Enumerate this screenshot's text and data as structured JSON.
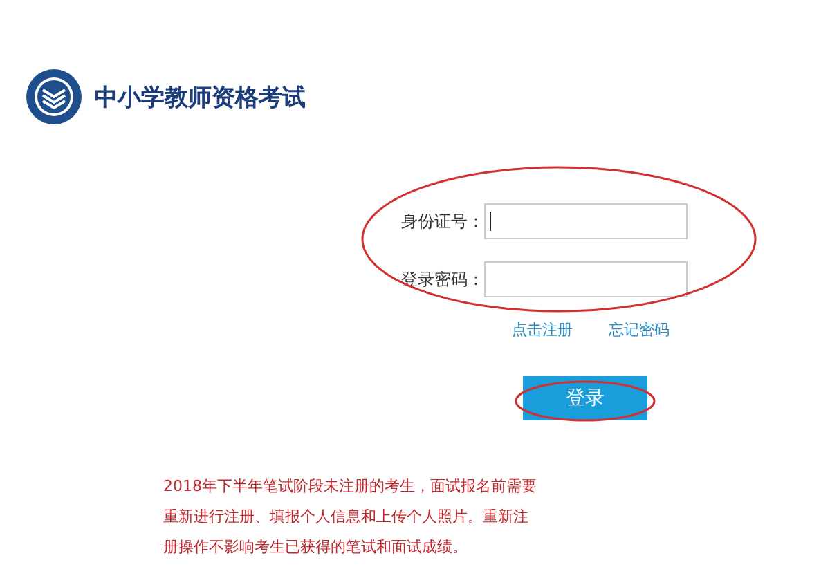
{
  "header": {
    "title": "中小学教师资格考试"
  },
  "login_form": {
    "fields": [
      {
        "label": "身份证号：",
        "focused": true
      },
      {
        "label": "登录密码：",
        "focused": false
      }
    ],
    "links": [
      "点击注册",
      "忘记密码"
    ],
    "submit": "登录",
    "fields_circled": true,
    "submit_circled": true
  },
  "notice": {
    "lines": [
      "2018年下半年笔试阶段未注册的考生，面试报名前需要",
      "重新进行注册、填报个人信息和上传个人照片。重新注",
      "册操作不影响考生已获得的笔试和面试成绩。"
    ]
  }
}
